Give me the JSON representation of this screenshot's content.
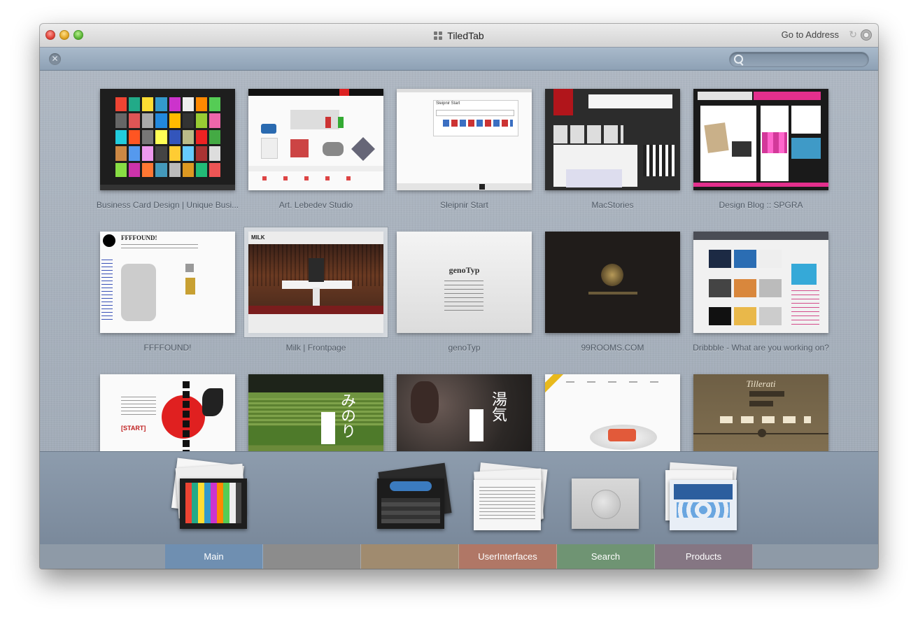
{
  "window": {
    "title": "TiledTab",
    "goto_label": "Go to Address",
    "icons": [
      "reload-icon",
      "gear-icon",
      "close-icon",
      "search-icon"
    ]
  },
  "search": {
    "value": "",
    "placeholder": ""
  },
  "tiles": [
    {
      "caption": "Business Card Design | Unique Busi..."
    },
    {
      "caption": "Art. Lebedev Studio"
    },
    {
      "caption": "Sleipnir Start"
    },
    {
      "caption": "MacStories"
    },
    {
      "caption": "Design Blog :: SPGRA"
    },
    {
      "caption": "FFFFOUND!"
    },
    {
      "caption": "Milk | Frontpage",
      "selected": true
    },
    {
      "caption": "genoTyp"
    },
    {
      "caption": "99ROOMS.COM"
    },
    {
      "caption": "Dribbble - What are you working on?"
    },
    {
      "caption": ""
    },
    {
      "caption": ""
    },
    {
      "caption": ""
    },
    {
      "caption": ""
    },
    {
      "caption": ""
    }
  ],
  "thumb_text": {
    "sleipnir": "Sleipnir Start",
    "fffound": "FFFFOUND!",
    "milk": "MILK",
    "genotyp": "genoTyp",
    "tillerati": "Tillerati",
    "start": "[START]",
    "kanji_1": "みのり",
    "kanji_2": "湯気"
  },
  "groups": {
    "active": "Main",
    "tabs": [
      {
        "label": "Main",
        "color": "#6f8fb1"
      },
      {
        "label": "",
        "color": "#8c8c8c"
      },
      {
        "label": "",
        "color": "#a08b6f"
      },
      {
        "label": "UserInterfaces",
        "color": "#b07766"
      },
      {
        "label": "Search",
        "color": "#6f9473"
      },
      {
        "label": "Products",
        "color": "#857683"
      }
    ]
  }
}
